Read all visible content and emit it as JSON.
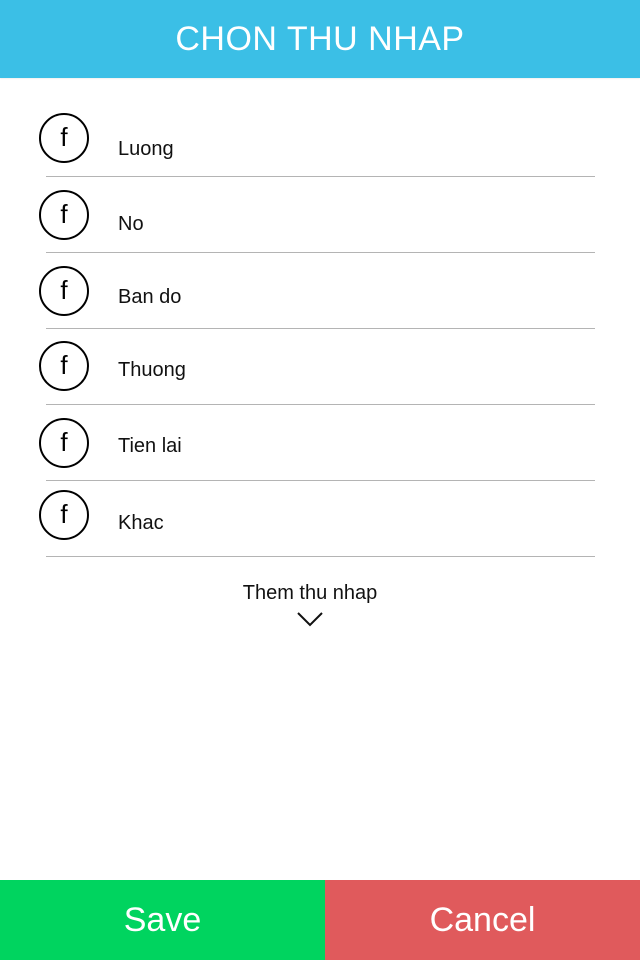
{
  "header": {
    "title": "CHON THU NHAP"
  },
  "income_items": [
    {
      "label": "Luong",
      "icon": "facebook-icon"
    },
    {
      "label": "No",
      "icon": "facebook-icon"
    },
    {
      "label": "Ban do",
      "icon": "facebook-icon"
    },
    {
      "label": "Thuong",
      "icon": "facebook-icon"
    },
    {
      "label": "Tien lai",
      "icon": "facebook-icon"
    },
    {
      "label": "Khac",
      "icon": "facebook-icon"
    }
  ],
  "icon_glyph": "f",
  "more": {
    "label": "Them thu nhap",
    "icon": "chevron-down-icon"
  },
  "footer": {
    "save_label": "Save",
    "cancel_label": "Cancel"
  },
  "colors": {
    "header_bg": "#3bbfe6",
    "save_bg": "#00d45f",
    "cancel_bg": "#e05a5c"
  }
}
